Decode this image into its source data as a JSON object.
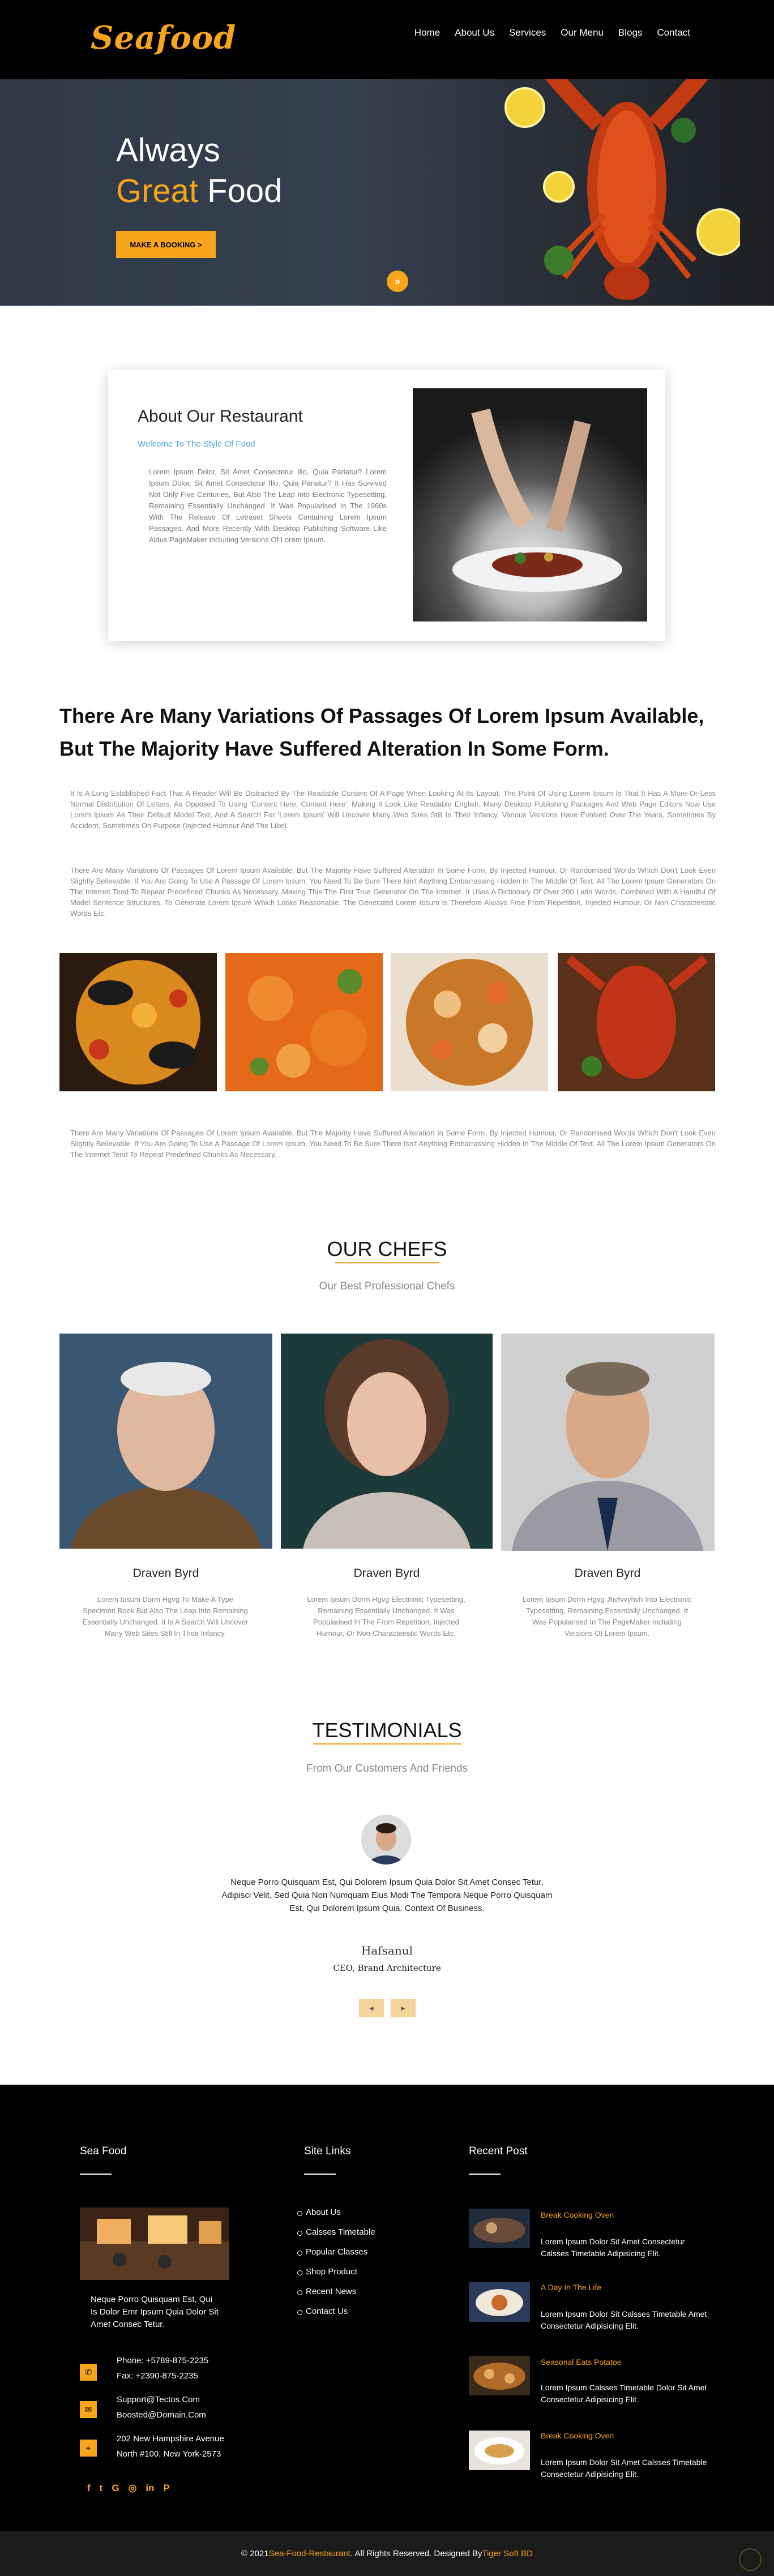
{
  "header": {
    "logo": "Seafood",
    "nav": [
      "Home",
      "About Us",
      "Services",
      "Our Menu",
      "Blogs",
      "Contact"
    ]
  },
  "hero": {
    "line1": "Always",
    "line2_highlight": "Great",
    "line2_rest": " Food",
    "button": "MAKE A BOOKING >",
    "down_icon": "chevron-double-down-icon"
  },
  "about": {
    "title": "About Our Restaurant",
    "subtitle": "Welcome To The Style Of Food",
    "text": "Lorem Ipsum Dolor, Sit Amet Consectetur Illo, Quia Pariatur? Lorem Ipsum Dolor, Sit Amet Consectetur Illo, Quia Pariatur? It Has Survived Not Only Five Centuries, But Also The Leap Into Electronic Typesetting, Remaining Essentially Unchanged. It Was Popularised In The 1960s With The Release Of Letraset Sheets Containing Lorem Ipsum Passages, And More Recently With Desktop Publishing Software Like Aldus PageMaker Including Versions Of Lorem Ipsum."
  },
  "variations": {
    "heading_normal": "There Are Many Variations Of Passages Of Lorem Ipsum Available, ",
    "heading_bold": "But The Majority Have Suffered Alteration In Some Form.",
    "para1": "It Is A Long Established Fact That A Reader Will Be Distracted By The Readable Content Of A Page When Looking At Its Layout. The Point Of Using Lorem Ipsum Is That It Has A More-Or-Less Normal Distribution Of Letters, As Opposed To Using 'Content Here, Content Here', Making It Look Like Readable English. Many Desktop Publishing Packages And Web Page Editors Now Use Lorem Ipsum As Their Default Model Text, And A Search For 'Lorem Ipsum' Will Uncover Many Web Sites Still In Their Infancy. Various Versions Have Evolved Over The Years, Sometimes By Accident, Sometimes On Purpose (Injected Humour And The Like).",
    "para2": "There Are Many Variations Of Passages Of Lorem Ipsum Available, But The Majority Have Suffered Alteration In Some Form, By Injected Humour, Or Randomised Words Which Don't Look Even Slightly Believable. If You Are Going To Use A Passage Of Lorem Ipsum, You Need To Be Sure There Isn't Anything Embarrassing Hidden In The Middle Of Text. All The Lorem Ipsum Generators On The Internet Tend To Repeat Predefined Chunks As Necessary, Making This The First True Generator On The Internet. It Uses A Dictionary Of Over 200 Latin Words, Combined With A Handful Of Model Sentence Structures, To Generate Lorem Ipsum Which Looks Reasonable. The Generated Lorem Ipsum Is Therefore Always Free From Repetition, Injected Humour, Or Non-Characteristic Words Etc.",
    "para3": "There Are Many Variations Of Passages Of Lorem Ipsum Available, But The Majority Have Suffered Alteration In Some Form, By Injected Humour, Or Randomised Words Which Don't Look Even Slightly Believable. If You Are Going To Use A Passage Of Lorem Ipsum, You Need To Be Sure There Isn't Anything Embarrassing Hidden In The Middle Of Text. All The Lorem Ipsum Generators On The Internet Tend To Repeat Predefined Chunks As Necessary."
  },
  "chefs": {
    "title": "OUR CHEFS",
    "subtitle": "Our Best Professional Chefs",
    "items": [
      {
        "name": "Draven Byrd",
        "text": "Lorem Ipsum Dorm Hgvg To Make A Type Specimen Book.But Also The Leap Into Remaining Essentially Unchanged. It Is A Search Will Uncover Many Web Sites Still In Their Infancy."
      },
      {
        "name": "Draven Byrd",
        "text": "Lorem Ipsum Dorm Hgvg Electronic Typesetting, Remaining Essentially Unchanged. It Was Popularised In The From Repetition, Injected Humour, Or Non-Characteristic Words Etc."
      },
      {
        "name": "Draven Byrd",
        "text": "Lorem Ipsum Dorm Hgvg Jhvfvvyhvh Into Electronic Typesetting, Remaining Essentially Unchanged. It Was Popularised In The PageMaker Including Versions Of Lorem Ipsum."
      }
    ]
  },
  "testimonials": {
    "title": "TESTIMONIALS",
    "subtitle": "From Our Customers And Friends",
    "quote": "Neque Porro Quisquam Est, Qui Dolorem Ipsum Quia Dolor Sit Amet Consec Tetur, Adipisci Velit, Sed Quia Non Numquam Eius Modi The Tempora Neque Porro Quisquam Est, Qui Dolorem Ipsum Quia. Context Of Business.",
    "name": "Hafsanul",
    "role": "CEO, Brand Architecture",
    "prev": "◄",
    "next": "►"
  },
  "footer": {
    "col1_title": "Sea Food",
    "col1_text": "Neque Porro Quisquam Est, Qui Is Dolor Emr Ipsum Quia Dolor Sit Amet Consec Tetur.",
    "phone1": "Phone: +5789-875-2235",
    "phone2": "Fax: +2390-875-2235",
    "email1": "Support@Tectos.Com",
    "email2": "Boosted@Domain.Com",
    "addr1": "202 New Hampshire Avenue",
    "addr2": "North #100, New York-2573",
    "social": [
      "f",
      "t",
      "G",
      "◎",
      "in",
      "P"
    ],
    "col2_title": "Site Links",
    "links": [
      "About Us",
      "Calsses Timetable",
      "Popular Classes",
      "Shop Product",
      "Recent News",
      "Contact Us"
    ],
    "col3_title": "Recent Post",
    "posts": [
      {
        "title": "Break Cooking Oven",
        "text": "Lorem Ipsum Dolor Sit Amet Consectetur Calsses Timetable Adipisicing Elit."
      },
      {
        "title": "A Day In The Life",
        "text": "Lorem Ipsum Dolor Sit Calsses Timetable Amet Consectetur Adipisicing Elit."
      },
      {
        "title": "Seasonal Eats Potatoe",
        "text": "Lorem Ipsum Calsses Timetable Dolor Sit Amet Consectetur Adipisicing Elit."
      },
      {
        "title": "Break Cooking Oven",
        "text": "Lorem Ipsum Dolor Sit Amet Calsses Timetable Consectetur Adipisicing Elit."
      }
    ],
    "copyright_pre": "© 2021 ",
    "copyright_brand": "Sea-Food-Restaurant",
    "copyright_mid": ". All Rights Reserved. Designed By ",
    "copyright_designer": "Tiger Soft BD"
  }
}
